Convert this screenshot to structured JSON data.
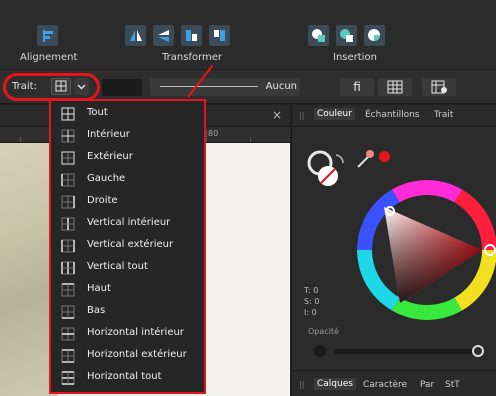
{
  "toolbar": {
    "groups": [
      {
        "label": "Alignement"
      },
      {
        "label": "Transformer"
      },
      {
        "label": "Insertion"
      }
    ],
    "colors": {
      "button_bg": "#3d4a58",
      "icon_blue": "#3aa0e8",
      "icon_teal": "#5cc8c0",
      "icon_white": "#ffffff"
    }
  },
  "context": {
    "trait_label": "Trait:",
    "stroke_none_label": "Aucun",
    "ligature_label": "fi",
    "grid_icon": "grid-icon",
    "chevron_icon": "chevron-down-icon"
  },
  "annotation_color": "#e8141c",
  "dropdown": {
    "items": [
      {
        "label": "Tout",
        "icon": "border-all-icon"
      },
      {
        "label": "Intérieur",
        "icon": "border-inner-icon"
      },
      {
        "label": "Extérieur",
        "icon": "border-outer-icon"
      },
      {
        "label": "Gauche",
        "icon": "border-left-icon"
      },
      {
        "label": "Droite",
        "icon": "border-right-icon"
      },
      {
        "label": "Vertical intérieur",
        "icon": "border-vertical-inner-icon"
      },
      {
        "label": "Vertical extérieur",
        "icon": "border-vertical-outer-icon"
      },
      {
        "label": "Vertical tout",
        "icon": "border-vertical-all-icon"
      },
      {
        "label": "Haut",
        "icon": "border-top-icon"
      },
      {
        "label": "Bas",
        "icon": "border-bottom-icon"
      },
      {
        "label": "Horizontal intérieur",
        "icon": "border-horizontal-inner-icon"
      },
      {
        "label": "Horizontal extérieur",
        "icon": "border-horizontal-outer-icon"
      },
      {
        "label": "Horizontal tout",
        "icon": "border-horizontal-all-icon"
      }
    ]
  },
  "document": {
    "ruler_value": "80",
    "close_icon": "close-icon"
  },
  "panel": {
    "tabs": [
      "Couleur",
      "Échantillons",
      "Trait"
    ],
    "active_tab": "Couleur",
    "tvalues": [
      "T: 0",
      "S: 0",
      "I: 0"
    ],
    "opacity_label": "Opacité",
    "fill_color": "#e8141c",
    "bottom_tabs": [
      "Calques",
      "Caractère",
      "Par",
      "StT"
    ]
  }
}
